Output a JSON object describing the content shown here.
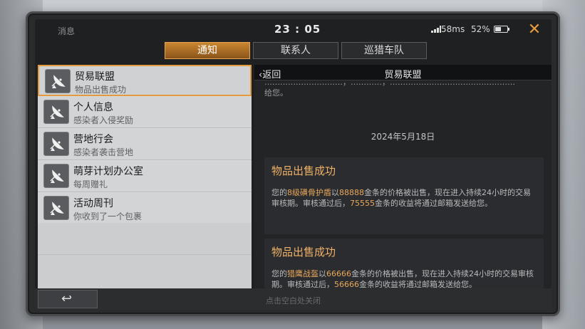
{
  "status": {
    "messages_label": "消息",
    "time": "23 : 05",
    "ping": "58ms",
    "battery_pct": "52%",
    "battery_level": 0.52,
    "close_icon": "close-icon"
  },
  "tabs": [
    {
      "label": "通知",
      "active": true
    },
    {
      "label": "联系人",
      "active": false
    },
    {
      "label": "巡猎车队",
      "active": false
    }
  ],
  "list": {
    "items": [
      {
        "title": "贸易联盟",
        "subtitle": "物品出售成功",
        "selected": true
      },
      {
        "title": "个人信息",
        "subtitle": "感染者入侵奖励"
      },
      {
        "title": "营地行会",
        "subtitle": "感染者袭击营地"
      },
      {
        "title": "萌芽计划办公室",
        "subtitle": "每周赠礼"
      },
      {
        "title": "活动周刊",
        "subtitle": "你收到了一个包裹"
      }
    ]
  },
  "detail": {
    "back_label": "返回",
    "title": "贸易联盟",
    "top_text_cut": "…………………………，…………，…………………………………………",
    "top_text_end": "给您。",
    "date": "2024年5月18日",
    "cards": [
      {
        "title": "物品出售成功",
        "p1": "您的",
        "item": "8级磺骨护盾",
        "p2": "以",
        "price": "88888",
        "p3": "金条的价格被出售，现在进入持续24小时的交易审核期。审核通过后，",
        "income": "75555",
        "p4": "金条的收益将通过邮箱发送给您。"
      },
      {
        "title": "物品出售成功",
        "p1": "您的",
        "item": "猎鹰战盔",
        "p2": "以",
        "price": "66666",
        "p3": "金条的价格被出售，现在进入持续24小时的交易审核期。审核通过后，",
        "income": "56666",
        "p4": "金条的收益将通过邮箱发送给您。"
      }
    ]
  },
  "bottom": {
    "back_icon": "return-arrow-icon",
    "hint": "点击空白处关闭"
  }
}
